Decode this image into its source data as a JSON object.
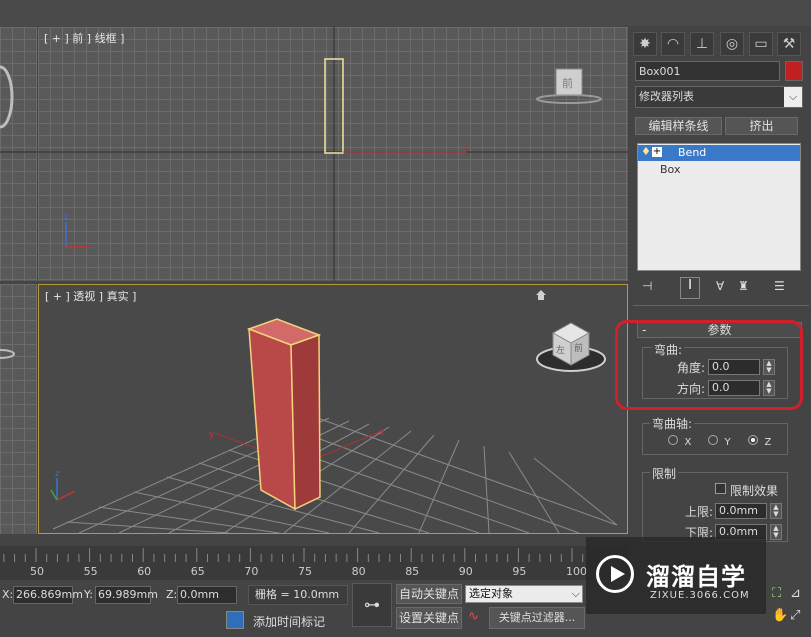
{
  "viewports": {
    "front_label": "[ + ] 前 ] 线框 ]",
    "persp_label": "[ + ] 透视 ] 真实 ]",
    "viewcube_front_text": "前",
    "viewcube_persp_text_a": "左",
    "viewcube_persp_text_b": "前"
  },
  "panel": {
    "object_name": "Box001",
    "modifier_list": "修改器列表",
    "btn_edit_spline": "编辑样条线",
    "btn_extrude": "挤出",
    "stack": [
      {
        "label": "Bend"
      },
      {
        "label": "Box"
      }
    ],
    "params": {
      "rollout_title": "参数",
      "bend_group": "弯曲:",
      "angle_label": "角度:",
      "angle_value": "0.0",
      "direction_label": "方向:",
      "direction_value": "0.0",
      "axis_group": "弯曲轴:",
      "axis_x": "X",
      "axis_y": "Y",
      "axis_z": "Z",
      "limit_group": "限制",
      "limit_effect": "限制效果",
      "upper_label": "上限:",
      "upper_value": "0.0mm",
      "lower_label": "下限:",
      "lower_value": "0.0mm"
    },
    "highlight_color": "#d0212a",
    "selected_color": "#3a78c8"
  },
  "timeline": {
    "ticks": [
      "50",
      "55",
      "60",
      "65",
      "70",
      "75",
      "80",
      "85",
      "90",
      "95",
      "100"
    ]
  },
  "status": {
    "x_label": "X:",
    "x_value": "266.869mm",
    "y_label": "Y:",
    "y_value": "69.989mm",
    "z_label": "Z:",
    "z_value": "0.0mm",
    "grid_text": "栅格 = 10.0mm",
    "add_time_tag": "添加时间标记",
    "auto_key": "自动关键点",
    "set_key": "设置关键点",
    "selected_object": "选定对象",
    "key_filters": "关键点过滤器..."
  },
  "watermark": {
    "brand": "溜溜自学",
    "url": "ZIXUE.3066.COM"
  }
}
